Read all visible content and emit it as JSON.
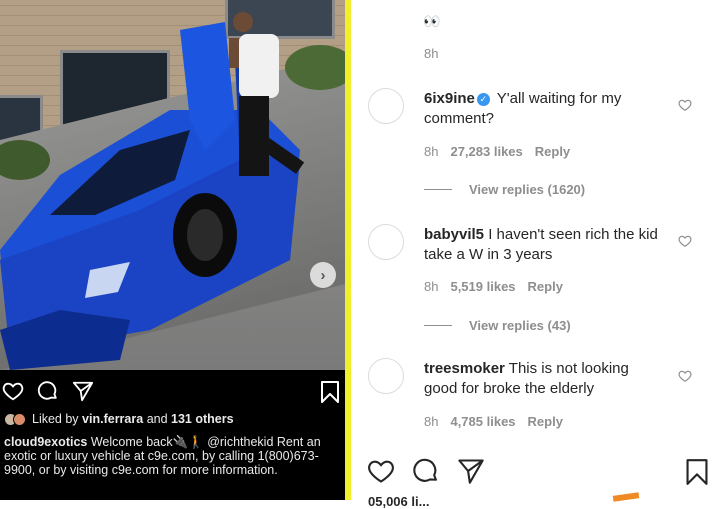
{
  "post": {
    "carousel_next": "›",
    "liked_by": {
      "prefix": "Liked by",
      "user": "vin.ferrara",
      "and": "and",
      "others": "131 others"
    },
    "caption": {
      "user": "cloud9exotics",
      "text": "Welcome back🔌🚶 @richthekid Rent an exotic or luxury vehicle at c9e.com, by calling 1(800)673-9900, or by visiting c9e.com for more information."
    }
  },
  "comments_panel": {
    "prev_emoji": "👀",
    "prev_time": "8h",
    "comments": [
      {
        "user": "6ix9ine",
        "verified": true,
        "text": "Y'all waiting for my comment?",
        "time": "8h",
        "likes": "27,283 likes",
        "reply": "Reply",
        "view_replies": "View replies (1620)"
      },
      {
        "user": "babyvil5",
        "verified": false,
        "text": "I haven't seen rich the kid take a W in 3 years",
        "time": "8h",
        "likes": "5,519 likes",
        "reply": "Reply",
        "view_replies": "View replies (43)"
      },
      {
        "user": "treesmoker",
        "verified": false,
        "text": "This is not looking good for broke the elderly",
        "time": "8h",
        "likes": "4,785 likes",
        "reply": "Reply"
      }
    ],
    "likes_partial": "05,006 li..."
  },
  "icons": {
    "heart": "heart-icon",
    "comment": "comment-icon",
    "share": "share-icon",
    "bookmark": "bookmark-icon",
    "verified": "verified-badge-icon"
  },
  "colors": {
    "accent_divider": "#f1ef2b",
    "verified": "#3897f0",
    "meta_gray": "#8e8e8e"
  }
}
